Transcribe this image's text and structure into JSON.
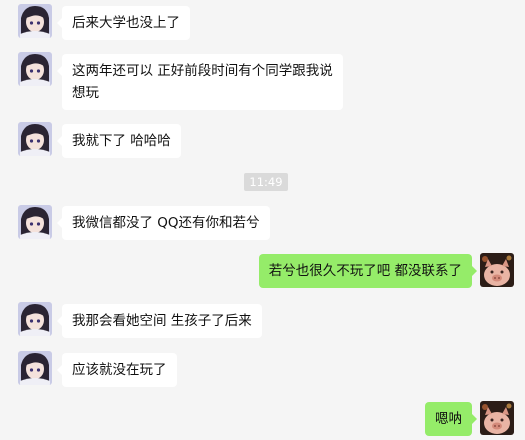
{
  "messages": [
    {
      "side": "left",
      "avatar": "anime-avatar",
      "lines": [
        "后来大学也没上了"
      ]
    },
    {
      "side": "left",
      "avatar": "anime-avatar",
      "lines": [
        "这两年还可以 正好前段时间有个同学跟我说",
        "想玩"
      ]
    },
    {
      "side": "left",
      "avatar": "anime-avatar",
      "lines": [
        "我就下了 哈哈哈"
      ]
    },
    {
      "side": "left",
      "avatar": "anime-avatar",
      "lines": [
        "我微信都没了 QQ还有你和若兮"
      ]
    },
    {
      "side": "right",
      "avatar": "pig-avatar",
      "lines": [
        "若兮也很久不玩了吧  都没联系了"
      ]
    },
    {
      "side": "left",
      "avatar": "anime-avatar",
      "lines": [
        "我那会看她空间 生孩子了后来"
      ]
    },
    {
      "side": "left",
      "avatar": "anime-avatar",
      "lines": [
        "应该就没在玩了"
      ]
    },
    {
      "side": "right",
      "avatar": "pig-avatar",
      "lines": [
        "嗯呐"
      ]
    }
  ],
  "timestamp": "11:49",
  "colors": {
    "background": "#f5f5f5",
    "incoming_bubble": "#ffffff",
    "outgoing_bubble": "#95ec69",
    "timestamp_bg": "#dadada"
  }
}
